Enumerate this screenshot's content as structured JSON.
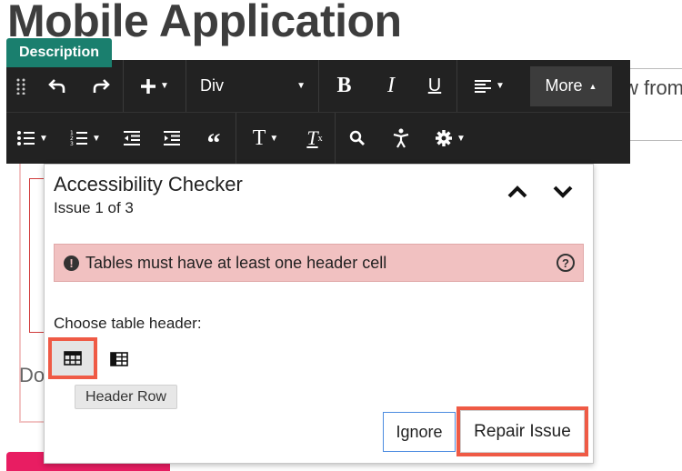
{
  "page": {
    "title": "Mobile Application",
    "bg_text": "w from",
    "bg_text_do": "Do"
  },
  "editor": {
    "tab_label": "Description"
  },
  "toolbar": {
    "block_select_value": "Div",
    "bold_label": "B",
    "italic_label": "I",
    "underline_label": "U",
    "more_label": "More",
    "quote_label": "“",
    "text_label": "T",
    "clear_label": "T",
    "icons": [
      "drag-handle-icon",
      "undo-icon",
      "redo-icon",
      "plus-icon",
      "align-icon",
      "bullet-list-icon",
      "numbered-list-icon",
      "outdent-icon",
      "indent-icon",
      "quote-icon",
      "text-format-icon",
      "clear-format-icon",
      "search-icon",
      "accessibility-icon",
      "gear-icon"
    ]
  },
  "checker": {
    "title": "Accessibility Checker",
    "issue_count": "Issue 1 of 3",
    "error_message": "Tables must have at least one header cell",
    "choose_label": "Choose table header:",
    "tooltip": "Header Row",
    "ignore_label": "Ignore",
    "repair_label": "Repair Issue",
    "colors": {
      "error_bg": "#f1c1c1",
      "highlight": "#ef5a45",
      "ignore_border": "#4b8be0"
    }
  }
}
